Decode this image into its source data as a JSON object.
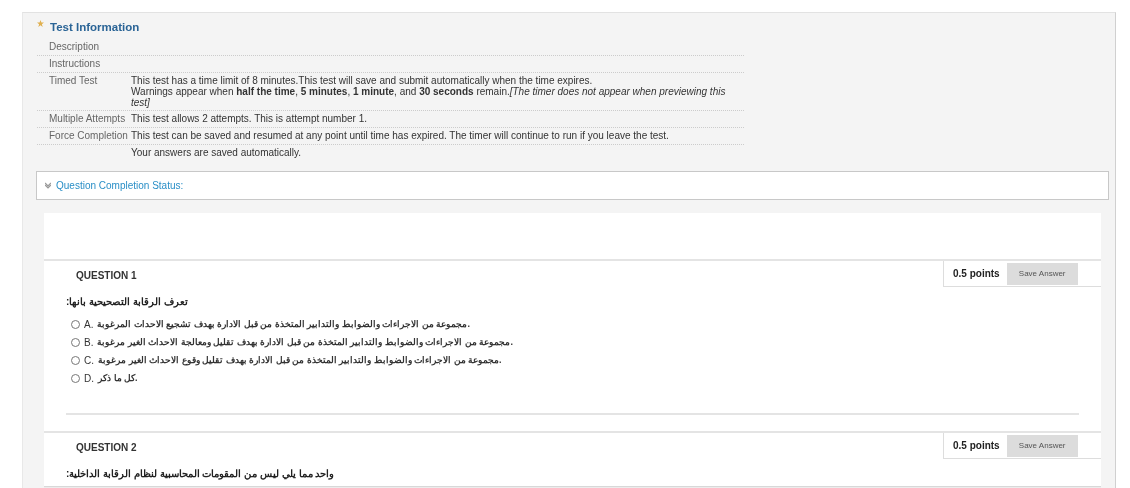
{
  "test_information": {
    "title": "Test Information",
    "rows": [
      {
        "label": "Description"
      },
      {
        "label": "Instructions"
      },
      {
        "label": "Timed Test",
        "lines": [
          "This test has a time limit of 8 minutes.This test will save and submit automatically when the time expires.",
          "Warnings appear when **half the time**, **5 minutes**, **1 minute**, and **30 seconds** remain.*[The timer does not appear when previewing this test]*"
        ]
      },
      {
        "label": "Multiple Attempts",
        "lines": [
          "This test allows 2 attempts. This is attempt number 1."
        ]
      },
      {
        "label": "Force Completion",
        "lines": [
          "This test can be saved and resumed at any point until time has expired. The timer will continue to run if you leave the test."
        ]
      },
      {
        "lines": [
          "Your answers are saved automatically."
        ]
      }
    ]
  },
  "completion_status": {
    "label": "Question Completion Status:",
    "expanded": false
  },
  "questions": [
    {
      "title": "QUESTION 1",
      "points": "0.5 points",
      "button": "Save Answer",
      "prompt": "تعرف الرقابة التصحيحية بانها:",
      "options": [
        {
          "letter": "A.",
          "text": "مجموعة من الاجراءات والضوابط والتدابير المتخذة من قبل الادارة بهدف تشجيع  الاحدات المرغوبة.",
          "selected": false
        },
        {
          "letter": "B.",
          "text": "مجموعة من الاجراءات والضوابط والتدابير المتخذة من قبل الادارة بهدف تقليل ومعالجة الاحداث الغير مرغوبة.",
          "selected": false
        },
        {
          "letter": "C.",
          "text": "مجموعة من الاجراءات والضوابط والتدابير المتخذة من قبل الادارة بهدف تقليل وقوع الاحداث الغير مرغوبة.",
          "selected": false
        },
        {
          "letter": "D.",
          "text": "كل ما ذكر.",
          "selected": false
        }
      ]
    },
    {
      "title": "QUESTION 2",
      "points": "0.5 points",
      "button": "Save Answer",
      "prompt": "واحد مما يلي ليس من المقومات المحاسبية لنظام الرقابة الداخلية:"
    }
  ]
}
